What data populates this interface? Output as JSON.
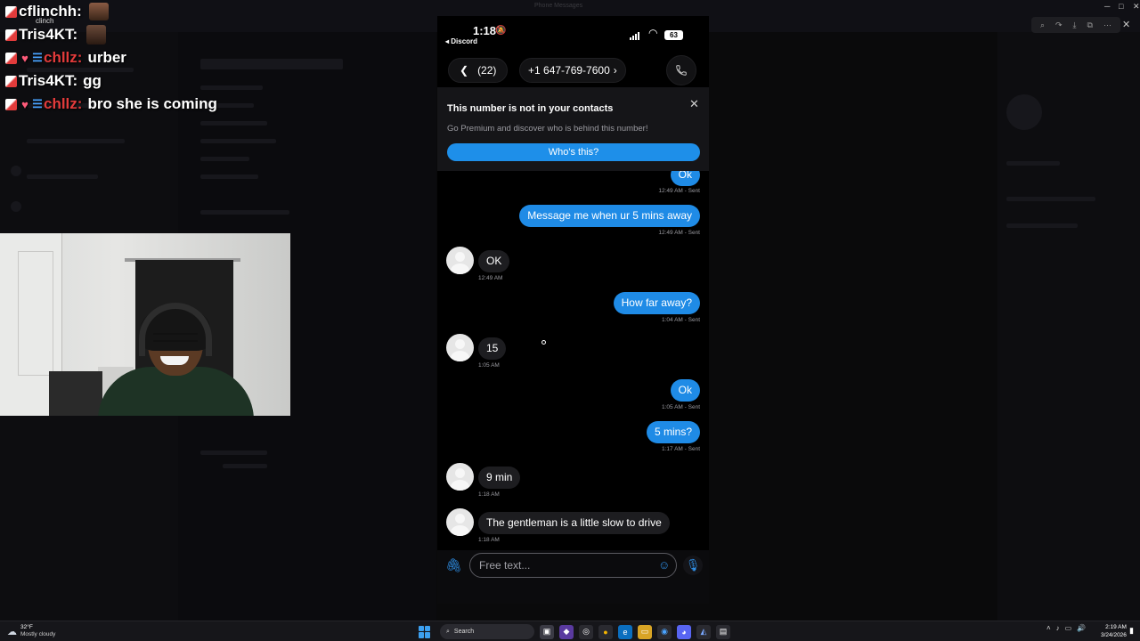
{
  "background_window": {
    "title": "Phone Messages"
  },
  "stream_chat": {
    "messages": [
      {
        "user": "cflinchh:",
        "text": "",
        "color": "#ffffff",
        "emote": true,
        "tag": "clinch"
      },
      {
        "user": "Tris4KT:",
        "text": "",
        "color": "#ffffff",
        "emote": true,
        "tag": ""
      },
      {
        "user": "chllz:",
        "text": "urber",
        "color": "#e23b3b",
        "emote": false,
        "tag": ""
      },
      {
        "user": "Tris4KT:",
        "text": "gg",
        "color": "#ffffff",
        "emote": false,
        "tag": ""
      },
      {
        "user": "chllz:",
        "text": "bro she is coming",
        "color": "#e23b3b",
        "emote": false,
        "tag": ""
      }
    ]
  },
  "phone": {
    "status": {
      "time": "1:18",
      "back_app": "◂ Discord",
      "battery": "63"
    },
    "nav": {
      "back_count": "(22)",
      "contact_number": "+1 647-769-7600"
    },
    "banner": {
      "title": "This number is not in your contacts",
      "subtitle": "Go Premium and discover who is behind this number!",
      "button": "Who's this?"
    },
    "messages": [
      {
        "dir": "out",
        "text": "Ok",
        "time": "12:49 AM - Sent"
      },
      {
        "dir": "out",
        "text": "Message me when ur 5 mins away",
        "time": "12:49 AM - Sent"
      },
      {
        "dir": "in",
        "text": "OK",
        "time": "12:49 AM"
      },
      {
        "dir": "out",
        "text": "How far away?",
        "time": "1:04 AM - Sent"
      },
      {
        "dir": "in",
        "text": "15",
        "time": "1:05 AM"
      },
      {
        "dir": "out",
        "text": "Ok",
        "time": "1:05 AM - Sent"
      },
      {
        "dir": "out",
        "text": "5 mins?",
        "time": "1:17 AM - Sent"
      },
      {
        "dir": "in",
        "text": "9 min",
        "time": "1:18 AM"
      },
      {
        "dir": "in",
        "text": "The gentleman is a little slow to drive",
        "time": "1:18 AM"
      }
    ],
    "composer": {
      "placeholder": "Free text..."
    },
    "accent_color": "#1f8be6"
  },
  "taskbar": {
    "weather_temp": "32°F",
    "weather_desc": "Mostly cloudy",
    "search_label": "Search",
    "clock_time": "2:19 AM",
    "clock_date": "3/24/2026"
  }
}
